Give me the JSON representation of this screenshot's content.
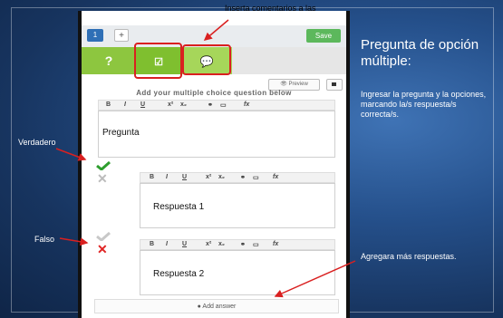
{
  "editor": {
    "tab_number": "1",
    "add_tab": "+",
    "save_label": "Save",
    "question_tab_icon": "?",
    "comment_tab_symbol": "☑",
    "feedback_tab_symbol": "💬",
    "preview_label": "👁 Preview",
    "heading": "Add your multiple choice question below",
    "toolbar_bold": "B",
    "toolbar_italic": "I",
    "toolbar_underline": "U",
    "toolbar_super": "x²",
    "toolbar_sub": "x₂",
    "toolbar_link": "⚭",
    "toolbar_image": "▭",
    "toolbar_formula": "fx",
    "question_text": "Pregunta",
    "answers": [
      {
        "text": "Respuesta 1",
        "correct": true
      },
      {
        "text": "Respuesta 2",
        "correct": false
      }
    ],
    "add_answer_label": "Add answer"
  },
  "annotations": {
    "top": "Inserta comentarios a las preguntas",
    "true_label": "Verdadero",
    "false_label": "Falso",
    "add_more": "Agregara más respuestas."
  },
  "sidebar": {
    "title": "Pregunta de opción múltiple:",
    "description": "Ingresar la pregunta y la opciones, marcando la/s respuesta/s correcta/s."
  },
  "colors": {
    "save_green": "#5cb85c",
    "tab_green": "#8dc63f",
    "annotation_red": "#d92020",
    "slide_blue": "#25508b"
  }
}
